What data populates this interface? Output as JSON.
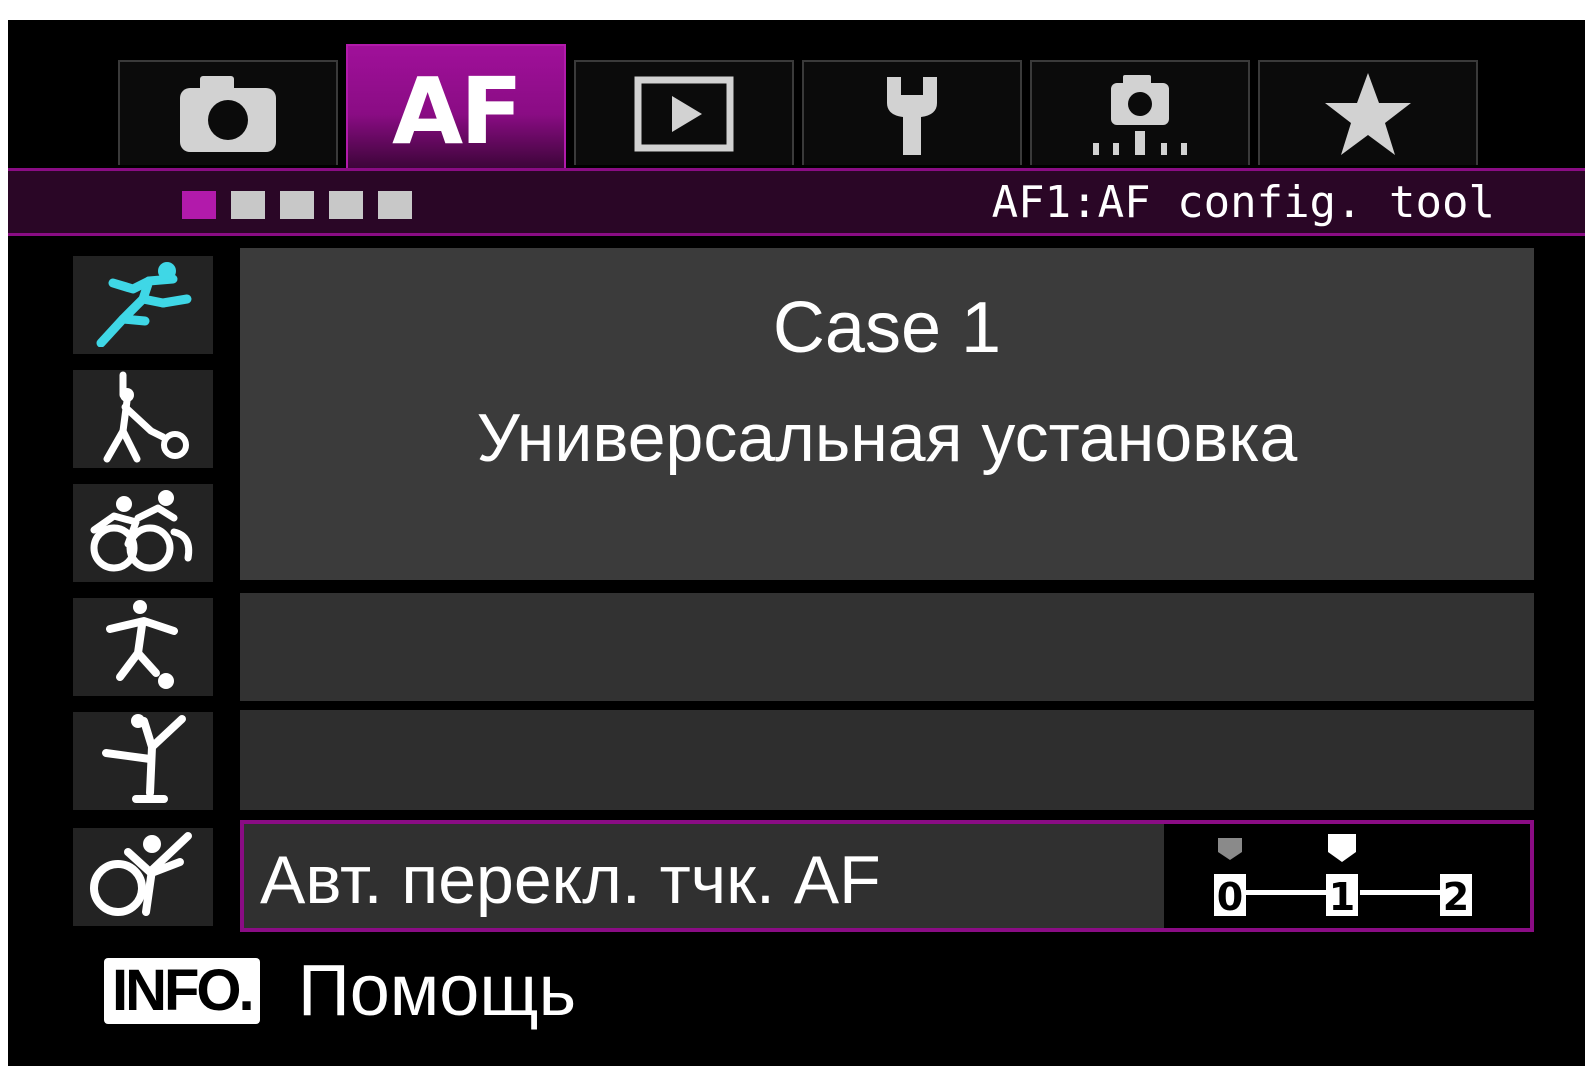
{
  "tabs": [
    {
      "icon": "camera-icon",
      "label": ""
    },
    {
      "icon": "",
      "label": "AF"
    },
    {
      "icon": "playback-icon",
      "label": ""
    },
    {
      "icon": "wrench-icon",
      "label": ""
    },
    {
      "icon": "camera-custom-icon",
      "label": ""
    },
    {
      "icon": "star-icon",
      "label": ""
    }
  ],
  "active_tab": "AF",
  "header": {
    "page_count": 5,
    "active_page": 1,
    "title": "AF1:AF config. tool"
  },
  "cases": {
    "icons": [
      "sprinter-icon",
      "tennis-player-icon",
      "cyclists-icon",
      "soccer-player-icon",
      "figure-skater-icon",
      "gymnast-icon"
    ],
    "selected_index": 0
  },
  "main": {
    "case_name": "Case 1",
    "case_description": "Универсальная установка"
  },
  "parameter": {
    "label": "Авт. перекл. тчк. AF",
    "scale_labels": [
      "0",
      "1",
      "2"
    ],
    "default_value": 0,
    "current_value": 1
  },
  "footer": {
    "info_button_label": "INFO.",
    "help_label": "Помощь"
  },
  "colors": {
    "accent": "#8a0c84",
    "accent_bright": "#b21aab",
    "background": "#000000",
    "selected_case_icon": "#3fd7e6"
  }
}
